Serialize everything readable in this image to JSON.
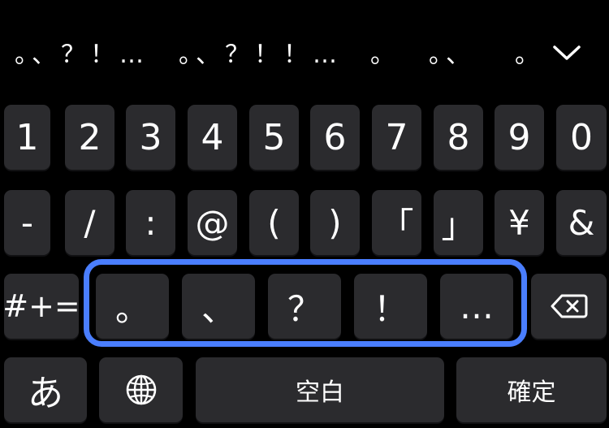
{
  "suggestions": [
    "。、？！…",
    "。、？！！…",
    "。",
    "。、",
    "。"
  ],
  "rows": {
    "numbers": [
      "1",
      "2",
      "3",
      "4",
      "5",
      "6",
      "7",
      "8",
      "9",
      "0"
    ],
    "symbols": [
      "-",
      "/",
      ":",
      "@",
      "(",
      ")",
      "「",
      "」",
      "¥",
      "&"
    ],
    "punct_toggle": "#+=",
    "punct": [
      "。",
      "、",
      "？",
      "！",
      "…"
    ]
  },
  "bottom": {
    "kana_label": "あ",
    "globe_icon": "globe-icon",
    "space_label": "空白",
    "confirm_label": "確定"
  },
  "icons": {
    "dismiss": "chevron-down-icon",
    "delete": "backspace-icon"
  },
  "colors": {
    "background": "#000000",
    "key": "#2b2b2e",
    "highlight": "#4a7eff"
  }
}
